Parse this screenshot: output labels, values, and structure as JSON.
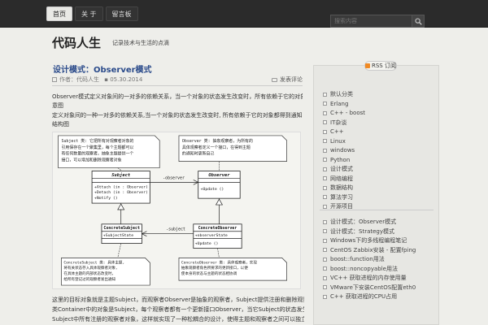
{
  "nav": {
    "items": [
      "首页",
      "关 于",
      "留言板"
    ],
    "active_index": 0
  },
  "search": {
    "placeholder": "搜索内容"
  },
  "site": {
    "title": "代码人生",
    "description": "记录技术与生活的点滴"
  },
  "post": {
    "title": "设计模式：Observer模式",
    "author": "作者：代码人生",
    "date": "05.30.2014",
    "comments": "发表评论",
    "paragraphs": [
      "Observer模式定义对象间的一对多的依赖关系，当一个对象的状态发生改变时，所有依赖于它的对象",
      "意图",
      "定义对象间的一种一对多的依赖关系,当一个对象的状态发生改变时, 所有依赖于它的对象都得到通知并被自动更新。[GOF 《设计模式》]",
      "结构图"
    ],
    "bottom_lines": [
      "这里的目标对象就是主题Subject，而观察者Observer是抽象的观察者，Subject提供注册和删除观察者对象的接口，Subject",
      "类Container中的对象是Subject，每个观察者都有一个更新接口Observer，当它Subject的状态发生改变时，就通知Observer去更新自己的",
      "Subject中所有注册的观察者对象，这样就实现了一种松耦合的设计，使得主题和观察者之间可以独立地变化和复用。"
    ]
  },
  "uml": {
    "note_subject": [
      "Subject 类: 它把所有对观察者对象的",
      "引用保存在一个聚集里，每个主题都可以",
      "有任何数量的观察者。抽象主题提供一个",
      "接口，可以增加和删除观察者对象"
    ],
    "note_observer": [
      "Observer 类: 抽象观察者，为所有的",
      "具体观察者定义一个接口，在得到主题",
      "的通知时更新自己"
    ],
    "subject_class": "Subject",
    "subject_methods": [
      "+Attach (in : Observer)",
      "+Detach (in : Observer)",
      "+Notify ()"
    ],
    "observer_class": "Observer",
    "observer_methods": [
      "+Update ()"
    ],
    "assoc_observer": "-observer",
    "assoc_subject": "-subject",
    "concrete_subject_class": "ConcreteSubject",
    "concrete_subject_attrs": [
      "+SubjectState"
    ],
    "concrete_observer_class": "ConcreteObserver",
    "concrete_observer_attrs": [
      "+observerState"
    ],
    "concrete_observer_methods": [
      "+Update ()"
    ],
    "note_concrete_subject": [
      "ConcreteSubject 类: 具体主题,",
      "将有关状态存入具体观察者对象,",
      "在具体主题的内部状态改变时，",
      "给所有登记过的观察者发出通知"
    ],
    "note_concrete_observer": [
      "ConcreteObserver 类: 具体观察者，实现",
      "抽象观察者角色所要求的更新接口，以便",
      "使本身的状态与主题的状态相协调"
    ]
  },
  "sidebar": {
    "rss_label": "RSS 订阅",
    "categories": [
      "默认分类",
      "Erlang",
      "C++ - boost",
      "IT杂谈",
      "C++",
      "Linux",
      "windows",
      "Python",
      "设计模式",
      "网络编程",
      "数据结构",
      "算法学习",
      "开源项目"
    ],
    "recent_posts": [
      "设计模式：Observer模式",
      "设计模式：Strategy模式",
      "Windows下的多线程编程笔记",
      "CentOS Zabbix安装 - 配置fping",
      "boost::function用法",
      "boost::noncopyable用法",
      "VC++ 获取进程的内存使用量",
      "VMware下安装CentOS配置eth0",
      "C++ 获取进程的CPU占用"
    ]
  }
}
